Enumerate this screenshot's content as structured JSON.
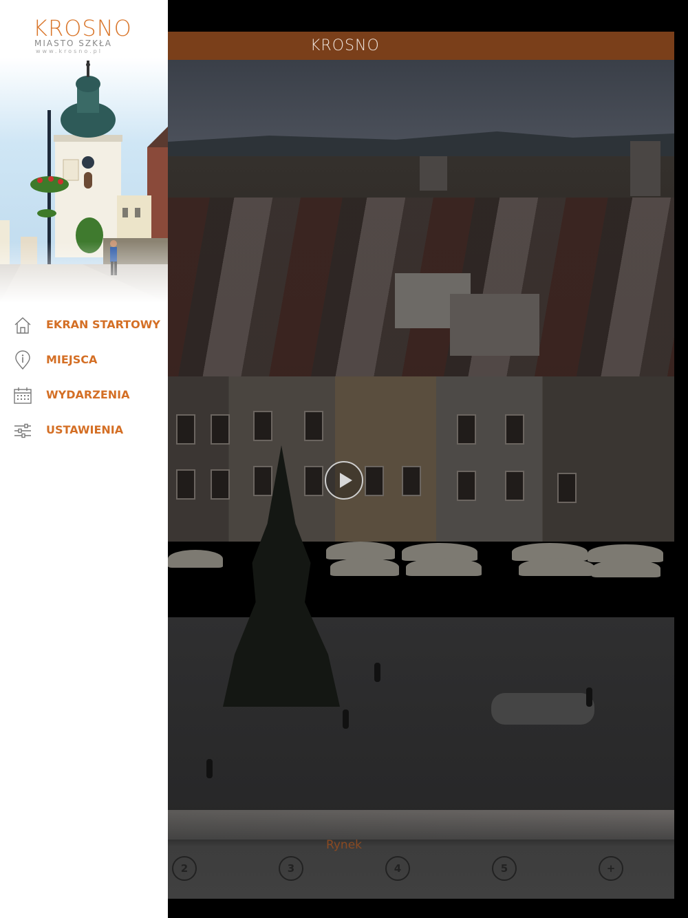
{
  "header": {
    "title": "KROSNO"
  },
  "drawer": {
    "brand": {
      "name": "KROSNO",
      "subtitle": "MIASTO SZKŁA",
      "url": "www.krosno.pl"
    },
    "menu": [
      {
        "label": "EKRAN STARTOWY",
        "icon": "home-icon"
      },
      {
        "label": "MIEJSCA",
        "icon": "info-pin-icon"
      },
      {
        "label": "WYDARZENIA",
        "icon": "calendar-icon"
      },
      {
        "label": "USTAWIENIA",
        "icon": "sliders-icon"
      }
    ]
  },
  "gallery": {
    "caption": "Rynek",
    "pages": [
      "2",
      "3",
      "4",
      "5",
      "+"
    ]
  },
  "colors": {
    "accent": "#d46f25",
    "header_bar": "#7a3f1a"
  }
}
